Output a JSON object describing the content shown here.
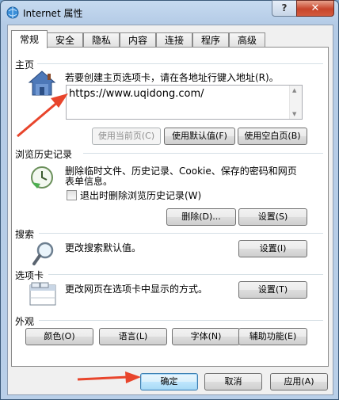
{
  "window": {
    "title": "Internet 属性",
    "help_label": "?",
    "close_label": "✕"
  },
  "tabs": [
    {
      "label": "常规",
      "active": true
    },
    {
      "label": "安全"
    },
    {
      "label": "隐私"
    },
    {
      "label": "内容"
    },
    {
      "label": "连接"
    },
    {
      "label": "程序"
    },
    {
      "label": "高级"
    }
  ],
  "home": {
    "section_label": "主页",
    "description": "若要创建主页选项卡，请在各地址行键入地址(R)。",
    "url_value": "https://www.uqidong.com/",
    "use_current_label": "使用当前页(C)",
    "use_default_label": "使用默认值(F)",
    "use_blank_label": "使用空白页(B)"
  },
  "history": {
    "section_label": "浏览历史记录",
    "description_line1": "删除临时文件、历史记录、Cookie、保存的密码和网页",
    "description_line2": "表单信息。",
    "checkbox_label": "退出时删除浏览历史记录(W)",
    "delete_label": "删除(D)...",
    "settings_label": "设置(S)"
  },
  "search": {
    "section_label": "搜索",
    "description": "更改搜索默认值。",
    "settings_label": "设置(I)"
  },
  "tabs_section": {
    "section_label": "选项卡",
    "description": "更改网页在选项卡中显示的方式。",
    "settings_label": "设置(T)"
  },
  "appearance": {
    "section_label": "外观",
    "colors_label": "颜色(O)",
    "languages_label": "语言(L)",
    "fonts_label": "字体(N)",
    "accessibility_label": "辅助功能(E)"
  },
  "footer": {
    "ok_label": "确定",
    "cancel_label": "取消",
    "apply_label": "应用(A)"
  },
  "colors": {
    "annotation_arrow": "#e8452c"
  }
}
